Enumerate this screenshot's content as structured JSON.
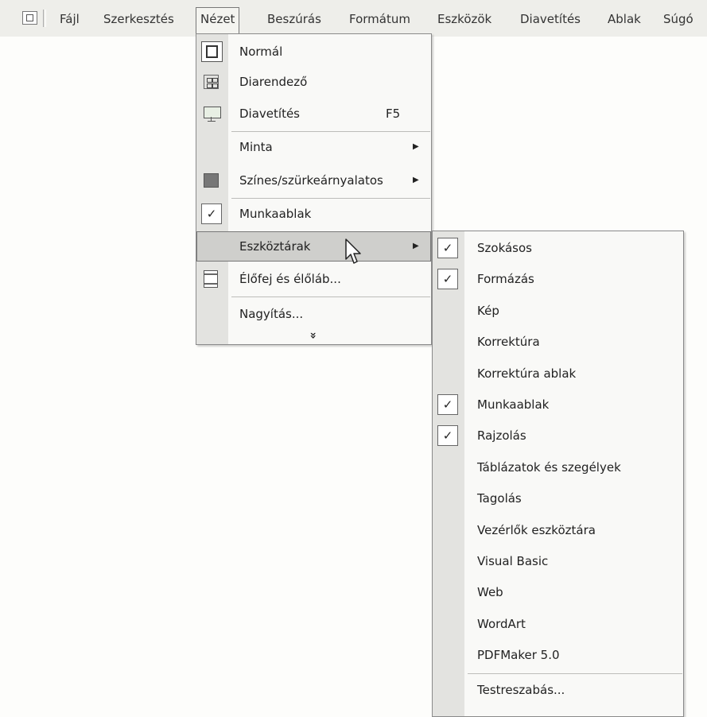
{
  "menubar": {
    "items": [
      "Fájl",
      "Szerkesztés",
      "Nézet",
      "Beszúrás",
      "Formátum",
      "Eszközök",
      "Diavetítés",
      "Ablak",
      "Súgó"
    ]
  },
  "view_menu": {
    "items": [
      {
        "label": "Normál",
        "icon": "normal-view-icon"
      },
      {
        "label": "Diarendező",
        "icon": "slide-sorter-icon"
      },
      {
        "label": "Diavetítés",
        "shortcut": "F5",
        "icon": "slide-show-icon"
      },
      {
        "label": "Minta",
        "submenu": true
      },
      {
        "label": "Színes/szürkeárnyalatos",
        "submenu": true,
        "icon": "color-grayscale-icon"
      },
      {
        "label": "Munkaablak",
        "checked": true
      },
      {
        "label": "Eszköztárak",
        "submenu": true,
        "highlighted": true
      },
      {
        "label": "Élőfej és élőláb...",
        "icon": "header-footer-icon"
      },
      {
        "label": "Nagyítás..."
      },
      {
        "label": "»",
        "expand": true
      }
    ]
  },
  "toolbars_menu": {
    "items": [
      {
        "label": "Szokásos",
        "checked": true
      },
      {
        "label": "Formázás",
        "checked": true
      },
      {
        "label": "Kép",
        "checked": false
      },
      {
        "label": "Korrektúra",
        "checked": false
      },
      {
        "label": "Korrektúra ablak",
        "checked": false
      },
      {
        "label": "Munkaablak",
        "checked": true
      },
      {
        "label": "Rajzolás",
        "checked": true
      },
      {
        "label": "Táblázatok és szegélyek",
        "checked": false
      },
      {
        "label": "Tagolás",
        "checked": false
      },
      {
        "label": "Vezérlők eszköztára",
        "checked": false
      },
      {
        "label": "Visual Basic",
        "checked": false
      },
      {
        "label": "Web",
        "checked": false
      },
      {
        "label": "WordArt",
        "checked": false
      },
      {
        "label": "PDFMaker 5.0",
        "checked": false
      },
      {
        "label": "Testreszabás...",
        "checked": false
      }
    ]
  },
  "colors": {
    "highlight": "#cfcfcc",
    "gutter": "#e3e3e0",
    "menubar": "#eeeeea"
  }
}
